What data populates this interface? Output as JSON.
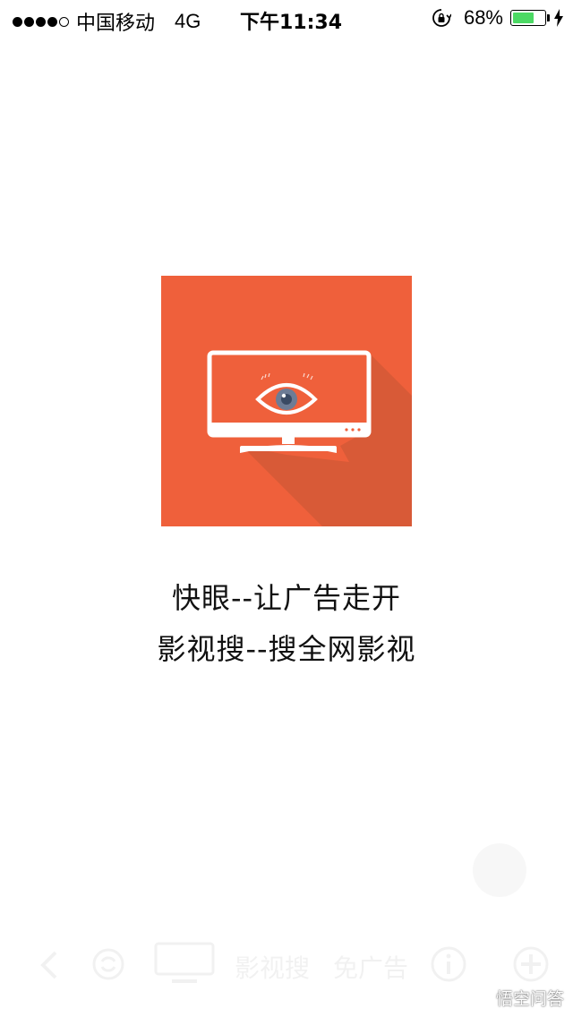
{
  "status_bar": {
    "carrier": "中国移动",
    "network": "4G",
    "time": "下午11:34",
    "battery_percent": "68%",
    "battery_level": 0.68,
    "signal_bars_filled": 4,
    "signal_bars_total": 5
  },
  "colors": {
    "logo_background": "#ef603b",
    "logo_shadow": "#d85a37",
    "battery_fill": "#4cd964"
  },
  "logo": {
    "icon": "monitor-eye-icon"
  },
  "slogans": {
    "line1": "快眼--让广告走开",
    "line2": "影视搜--搜全网影视"
  },
  "toolbar": {
    "label_search": "影视搜",
    "label_noad": "免广告",
    "icons": [
      "back-icon",
      "refresh-icon",
      "tv-icon",
      "info-icon",
      "plus-icon"
    ]
  },
  "watermark": {
    "text": "悟空问答",
    "icon": "wukong-logo-icon"
  }
}
